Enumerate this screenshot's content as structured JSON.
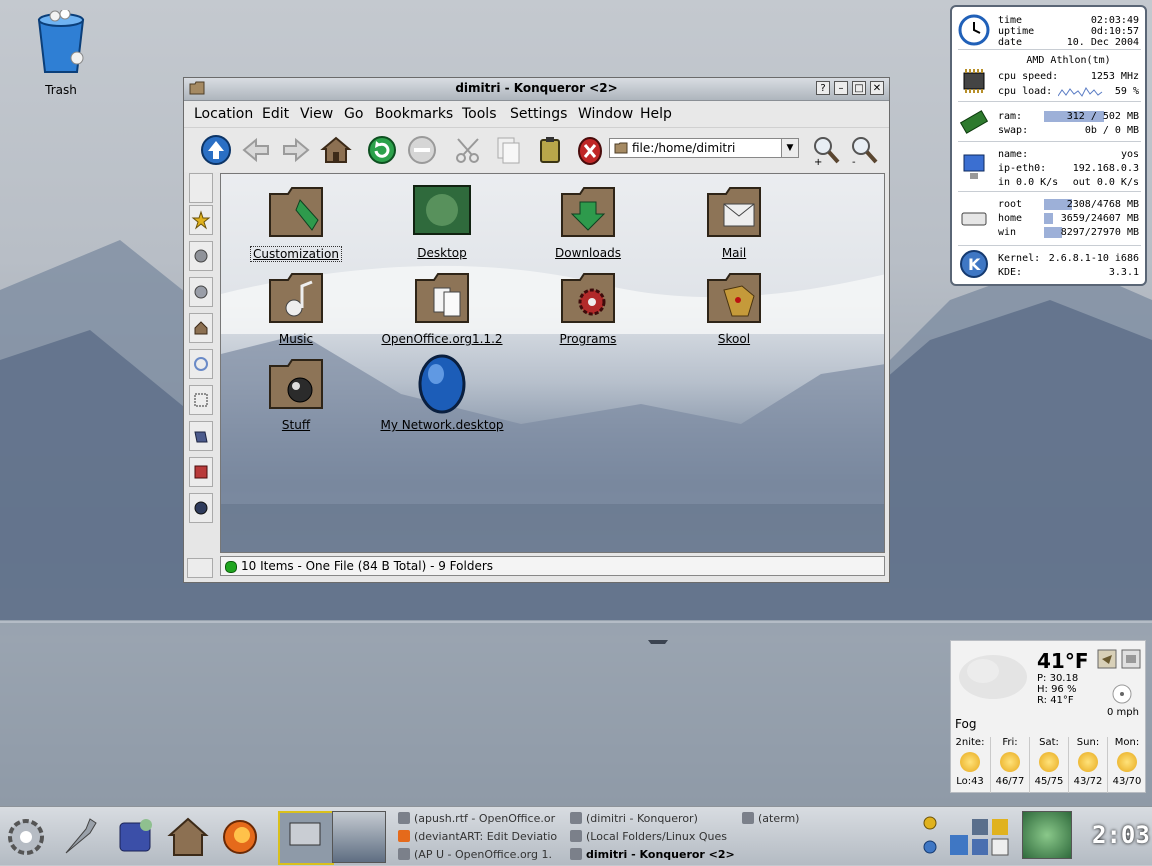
{
  "desktop": {
    "trash_label": "Trash"
  },
  "window": {
    "title": "dimitri - Konqueror <2>",
    "menu": [
      "Location",
      "Edit",
      "View",
      "Go",
      "Bookmarks",
      "Tools",
      "Settings",
      "Window",
      "Help"
    ],
    "url": "file:/home/dimitri",
    "items": [
      {
        "label": "Customization",
        "icon": "folder-brush-icon",
        "selected": true
      },
      {
        "label": "Desktop",
        "icon": "desktop-icon"
      },
      {
        "label": "Downloads",
        "icon": "folder-download-icon"
      },
      {
        "label": "Mail",
        "icon": "folder-mail-icon"
      },
      {
        "label": "Music",
        "icon": "folder-music-icon"
      },
      {
        "label": "OpenOffice.org1.1.2",
        "icon": "folder-openoffice-icon"
      },
      {
        "label": "Programs",
        "icon": "folder-programs-icon"
      },
      {
        "label": "Skool",
        "icon": "folder-skool-icon"
      },
      {
        "label": "Stuff",
        "icon": "folder-stuff-icon"
      },
      {
        "label": "My Network.desktop",
        "icon": "network-egg-icon"
      }
    ],
    "status": "10 Items - One File (84 B Total) - 9 Folders"
  },
  "sysmon": {
    "time_label": "time",
    "time": "02:03:49",
    "uptime_label": "uptime",
    "uptime": "0d:10:57",
    "date_label": "date",
    "date": "10. Dec 2004",
    "cpu_name": "AMD Athlon(tm)",
    "cpu_speed_label": "cpu speed:",
    "cpu_speed": "1253 MHz",
    "cpu_load_label": "cpu load:",
    "cpu_load": "59 %",
    "ram_label": "ram:",
    "ram": "312 / 502 MB",
    "ram_fraction": 0.62,
    "swap_label": "swap:",
    "swap": "0b / 0 MB",
    "name_label": "name:",
    "name": "yos",
    "ip_label": "ip-eth0:",
    "ip": "192.168.0.3",
    "in_label": "in 0.0 K/s",
    "out_label": "out 0.0 K/s",
    "disks": [
      {
        "label": "root",
        "value": "2308/4768 MB",
        "fraction": 0.48
      },
      {
        "label": "home",
        "value": "3659/24607 MB",
        "fraction": 0.15
      },
      {
        "label": "win",
        "value": "8297/27970 MB",
        "fraction": 0.3
      }
    ],
    "kernel_label": "Kernel:",
    "kernel": "2.6.8.1-10 i686",
    "kde_label": "KDE:",
    "kde": "3.3.1"
  },
  "weather": {
    "temp": "41°F",
    "pressure": "P: 30.18",
    "humidity": "H: 96 %",
    "realfeel": "R: 41°F",
    "condition": "Fog",
    "wind": "0 mph",
    "forecast": [
      {
        "day": "2nite:",
        "temps": "Lo:43"
      },
      {
        "day": "Fri:",
        "temps": "46/77"
      },
      {
        "day": "Sat:",
        "temps": "45/75"
      },
      {
        "day": "Sun:",
        "temps": "43/72"
      },
      {
        "day": "Mon:",
        "temps": "43/70"
      }
    ]
  },
  "taskbar": {
    "tasks": [
      {
        "label": "(apush.rtf - OpenOffice.or",
        "active": false
      },
      {
        "label": "(dimitri - Konqueror)",
        "active": false
      },
      {
        "label": "(aterm)",
        "active": false
      },
      {
        "label": "(deviantART: Edit Deviatio",
        "active": false
      },
      {
        "label": "(Local Folders/Linux Ques",
        "active": false
      },
      {
        "label": "(AP U - OpenOffice.org 1.",
        "active": false
      },
      {
        "label": "dimitri - Konqueror <2>",
        "active": true
      }
    ],
    "clock": "2:03"
  }
}
